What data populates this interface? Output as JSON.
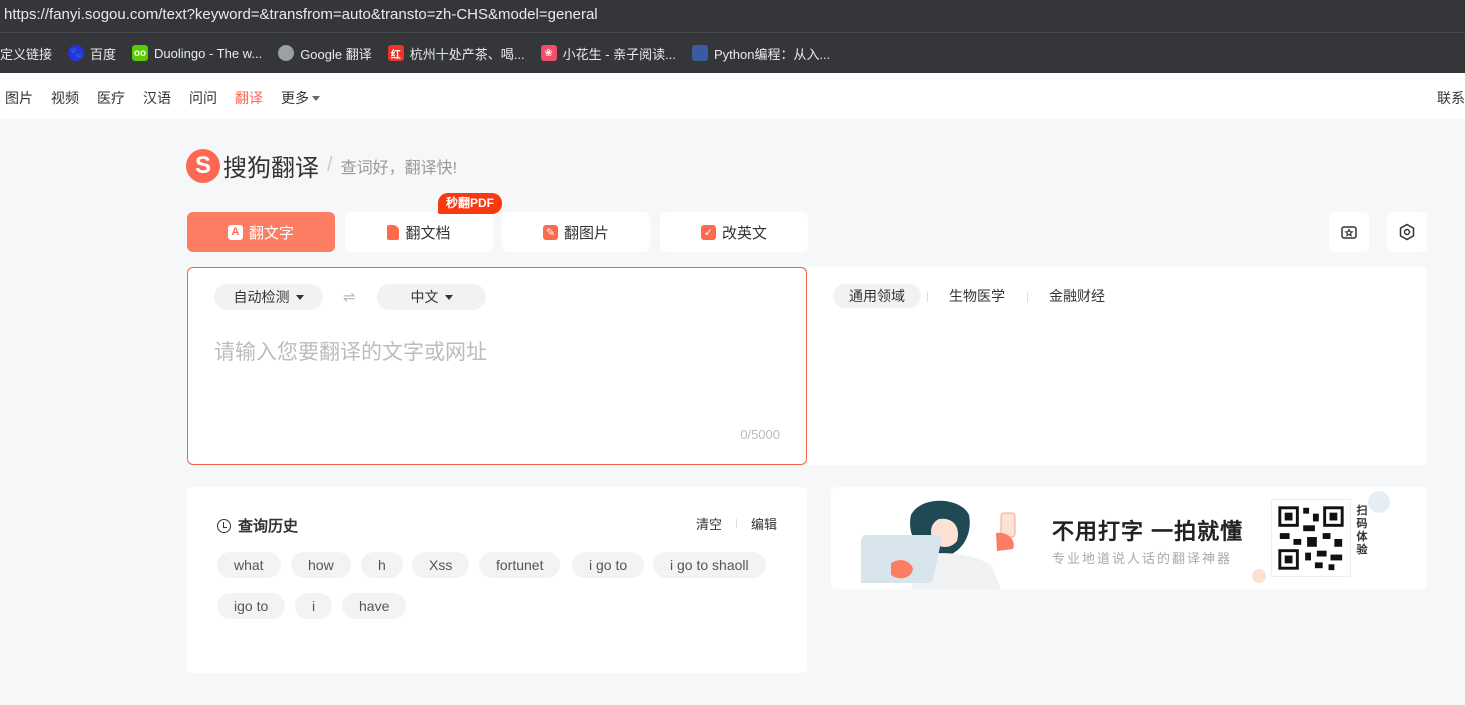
{
  "browser": {
    "url": "https://fanyi.sogou.com/text?keyword=&transfrom=auto&transto=zh-CHS&model=general",
    "bookmarks": [
      {
        "label": "定义链接",
        "icon": "none"
      },
      {
        "label": "百度",
        "icon": "baidu-paw-icon",
        "color": "#2932e1"
      },
      {
        "label": "Duolingo - The w...",
        "icon": "duolingo-owl-icon",
        "color": "#58cc02"
      },
      {
        "label": "Google 翻译",
        "icon": "globe-icon",
        "color": "#9aa0a6"
      },
      {
        "label": "杭州十处产茶、喝...",
        "icon": "red-logo-icon",
        "color": "#e8372a"
      },
      {
        "label": "小花生 - 亲子阅读...",
        "icon": "flower-logo-icon",
        "color": "#f04f6a"
      },
      {
        "label": "Python编程：从入...",
        "icon": "book-icon",
        "color": "#3a5ba0"
      }
    ]
  },
  "nav": {
    "items": [
      {
        "label": "图片",
        "active": false
      },
      {
        "label": "视频",
        "active": false
      },
      {
        "label": "医疗",
        "active": false
      },
      {
        "label": "汉语",
        "active": false
      },
      {
        "label": "问问",
        "active": false
      },
      {
        "label": "翻译",
        "active": true
      },
      {
        "label": "更多",
        "active": false
      }
    ],
    "right_label": "联系"
  },
  "logo": {
    "mark": "S",
    "name": "搜狗翻译",
    "slogan": "查词好，翻译快!"
  },
  "tabs": [
    {
      "label": "翻文字",
      "icon": "A",
      "active": true
    },
    {
      "label": "翻文档",
      "icon": "",
      "active": false
    },
    {
      "label": "翻图片",
      "icon": "",
      "active": false
    },
    {
      "label": "改英文",
      "icon": "",
      "active": false
    }
  ],
  "pdf_badge": "秒翻PDF",
  "input": {
    "source_lang": "自动检测",
    "target_lang": "中文",
    "swap": "⇌",
    "placeholder": "请输入您要翻译的文字或网址",
    "counter": "0/5000"
  },
  "domains": [
    {
      "label": "通用领域",
      "active": true
    },
    {
      "label": "生物医学",
      "active": false
    },
    {
      "label": "金融财经",
      "active": false
    }
  ],
  "history": {
    "title": "查询历史",
    "clear": "清空",
    "edit": "编辑",
    "items": [
      "what",
      "how",
      "h",
      "Xss",
      "fortunet",
      "i go to",
      "i go to shaoll",
      "igo to",
      "i",
      "have"
    ]
  },
  "banner": {
    "title": "不用打字  一拍就懂",
    "subtitle": "专业地道说人话的翻译神器",
    "scan_tag": "扫码体验"
  },
  "colors": {
    "accent": "#fd6853",
    "browser_bg": "#35363a"
  }
}
